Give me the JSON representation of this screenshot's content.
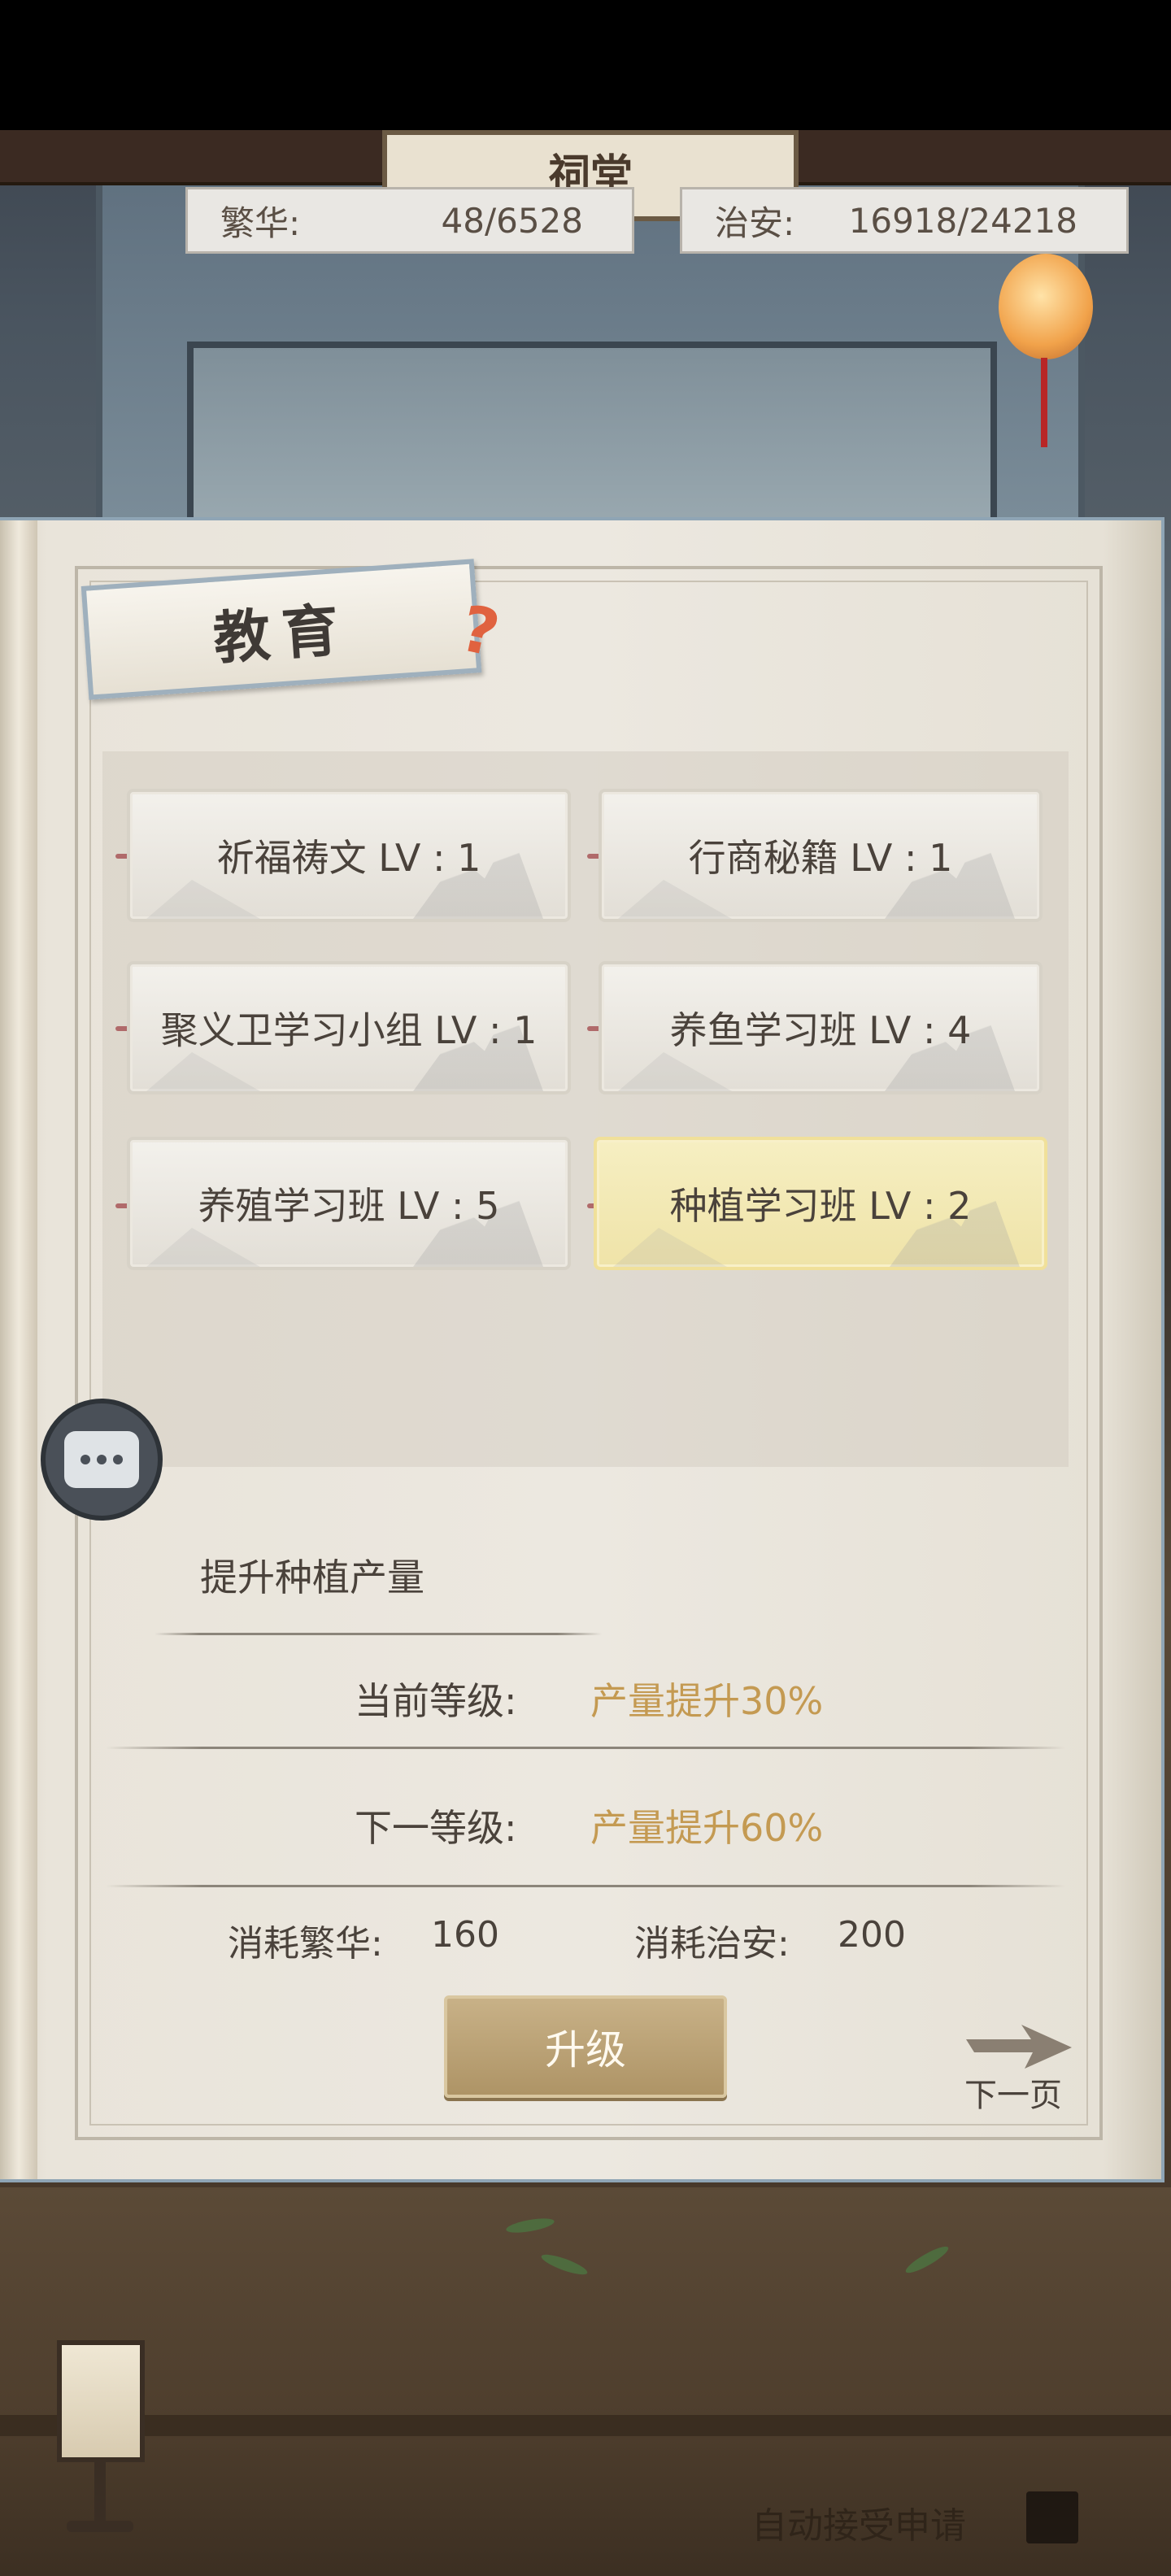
{
  "background": {
    "sign_text": "祠堂"
  },
  "resources": {
    "prosperity": {
      "label": "繁华:",
      "value": "48/6528"
    },
    "security": {
      "label": "治安:",
      "value": "16918/24218"
    }
  },
  "panel": {
    "title": "教育",
    "help_symbol": "?",
    "skills": [
      {
        "label": "祈福祷文 LV : 1",
        "selected": false
      },
      {
        "label": "行商秘籍 LV : 1",
        "selected": false
      },
      {
        "label": "聚义卫学习小组 LV : 1",
        "selected": false
      },
      {
        "label": "养鱼学习班 LV : 4",
        "selected": false
      },
      {
        "label": "养殖学习班 LV : 5",
        "selected": false
      },
      {
        "label": "种植学习班 LV : 2",
        "selected": true
      }
    ],
    "detail": {
      "description": "提升种植产量",
      "current_level_label": "当前等级:",
      "current_level_value": "产量提升30%",
      "next_level_label": "下一等级:",
      "next_level_value": "产量提升60%",
      "cost_prosperity_label": "消耗繁华:",
      "cost_prosperity_value": "160",
      "cost_security_label": "消耗治安:",
      "cost_security_value": "200"
    },
    "upgrade_label": "升级",
    "next_page_label": "下一页"
  },
  "footer": {
    "auto_accept_label": "自动接受申请"
  },
  "colors": {
    "accent_gold": "#c49a52",
    "selected_card": "#f2e8b4",
    "upgrade_button": "#b99d6f",
    "help_icon": "#e0623f"
  },
  "icons": {
    "help": "question-mark-icon",
    "chat": "chat-bubble-icon",
    "next_page": "arrow-right-icon",
    "lamp": "lantern-icon"
  }
}
